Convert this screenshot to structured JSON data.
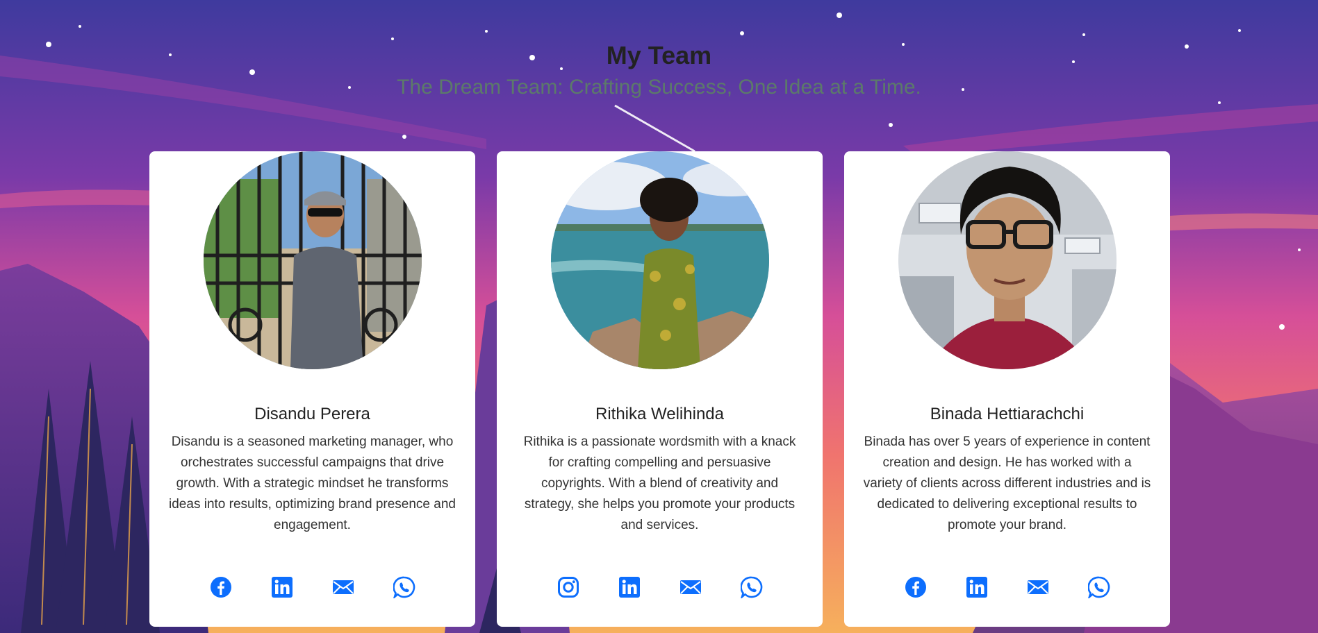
{
  "header": {
    "title": "My Team",
    "subtitle": "The Dream Team: Crafting Success, One Idea at a Time."
  },
  "colors": {
    "icon_blue": "#0d6efd",
    "sky_top": "#3e3b9b",
    "sky_mid": "#c74a9a",
    "sky_low": "#f39a6c",
    "card_bg": "#ffffff"
  },
  "team": [
    {
      "name": "Disandu Perera",
      "bio": "Disandu is a seasoned marketing manager, who orchestrates successful campaigns that drive growth. With a strategic mindset he transforms ideas into results, optimizing brand presence and engagement.",
      "photo": "man with grey cap and sunglasses in front of black iron gate",
      "socials": [
        "facebook-icon",
        "linkedin-icon",
        "email-icon",
        "whatsapp-icon"
      ]
    },
    {
      "name": "Rithika Welihinda",
      "bio": "Rithika is a passionate wordsmith with a knack for crafting compelling and persuasive copyrights. With a blend of creativity and strategy, she helps you promote your products and services.",
      "photo": "person in floral shirt standing by the sea on rocks",
      "socials": [
        "instagram-icon",
        "linkedin-icon",
        "email-icon",
        "whatsapp-icon"
      ]
    },
    {
      "name": "Binada Hettiarachchi",
      "bio": "Binada has over 5 years of experience in content creation and design. He has worked with a variety of clients across different industries and is dedicated to delivering exceptional results to promote your brand.",
      "photo": "young man with glasses and maroon shirt indoors",
      "socials": [
        "facebook-icon",
        "linkedin-icon",
        "email-icon",
        "whatsapp-icon"
      ]
    }
  ]
}
